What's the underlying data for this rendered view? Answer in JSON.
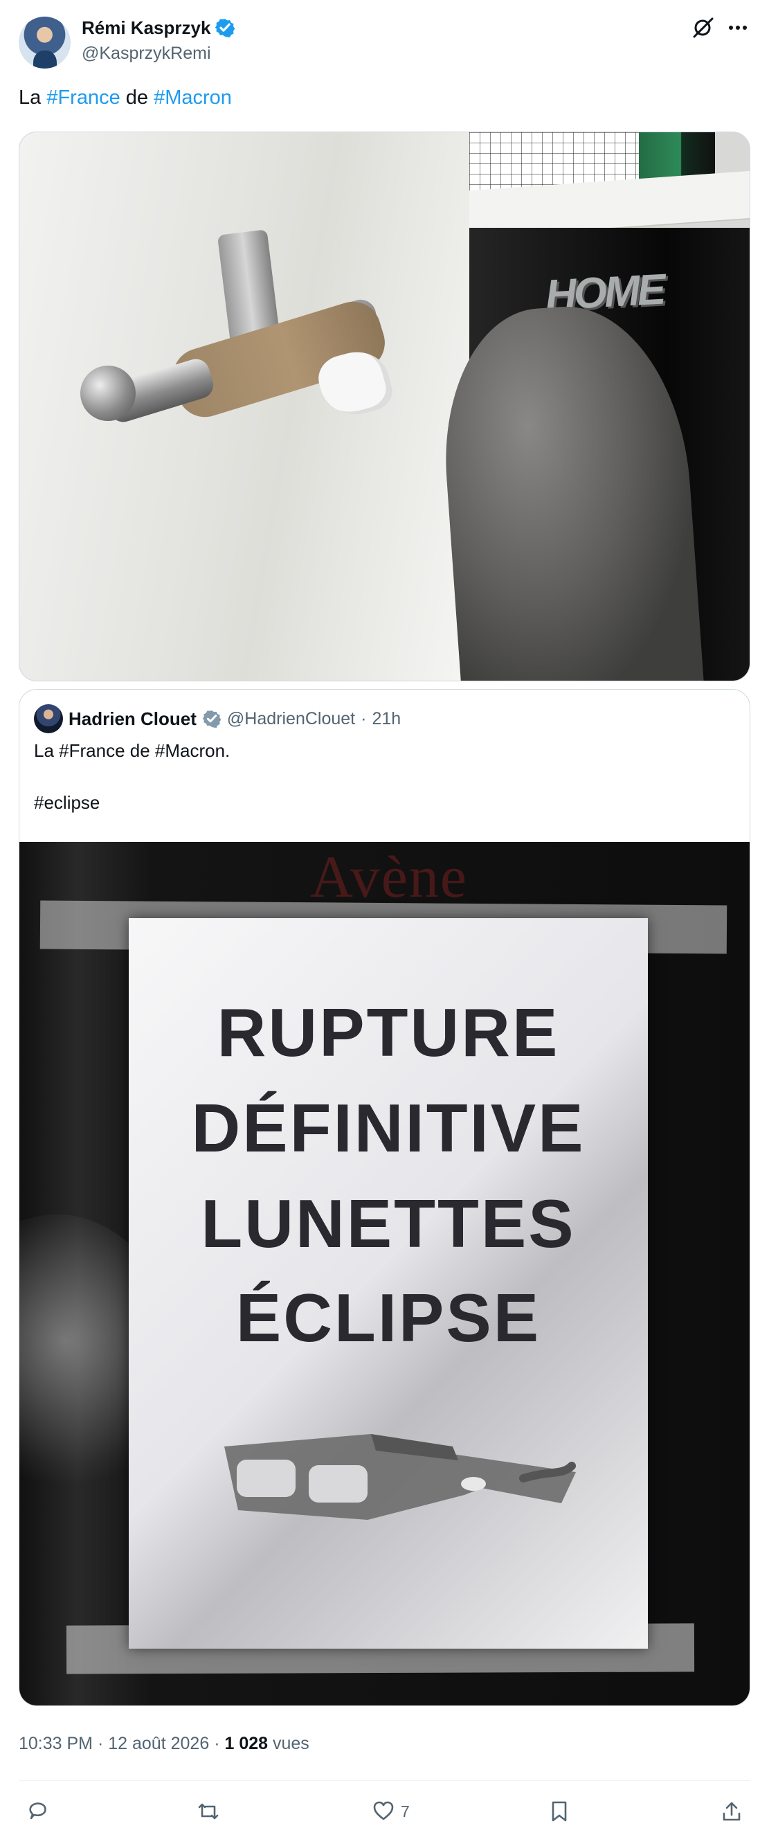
{
  "author": {
    "display_name": "Rémi Kasprzyk",
    "handle": "@KasprzykRemi",
    "verified_icon": "verified-badge-icon"
  },
  "tweet": {
    "prefix": "La ",
    "hashtag_1": "#France",
    "middle": " de ",
    "hashtag_2": "#Macron"
  },
  "image": {
    "home_word": "HOME"
  },
  "quoted_tweet": {
    "display_name": "Hadrien Clouet",
    "handle": "@HadrienClouet",
    "time": "21h",
    "line_1": "La #France de #Macron.",
    "line_2": "#eclipse",
    "reflection_text": "Avène",
    "sign_lines": [
      "RUPTURE",
      "DÉFINITIVE",
      "LUNETTES",
      "ÉCLIPSE"
    ]
  },
  "meta": {
    "time": "10:33 PM",
    "date": "12 août 2026",
    "views_count": "1 028",
    "views_label": "vues"
  },
  "actions": {
    "like_count": "7"
  },
  "colors": {
    "accent": "#1d9bf0",
    "text": "#0f1419",
    "muted": "#536471",
    "border": "#cfd9de"
  }
}
